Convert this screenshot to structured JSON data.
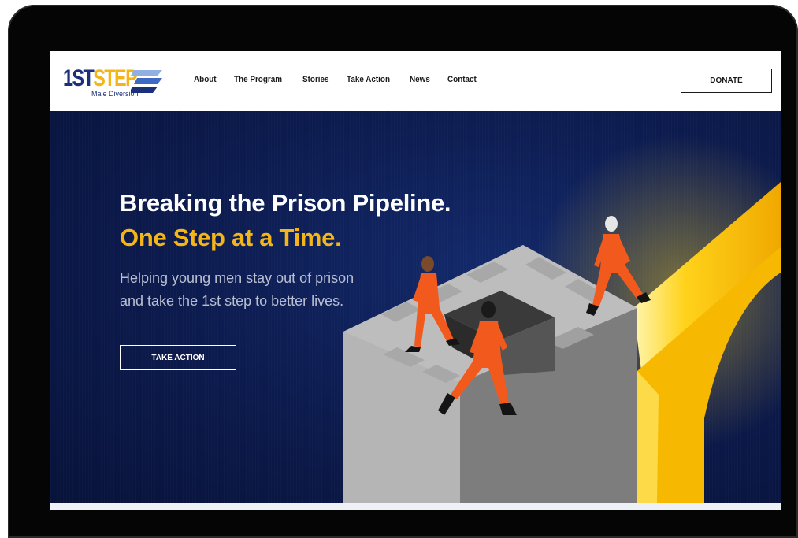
{
  "logo": {
    "part_a": "1ST",
    "part_b": "STEP",
    "subtitle": "Male Diversion"
  },
  "nav": {
    "links": [
      "About",
      "The Program",
      "Stories",
      "Take Action",
      "News",
      "Contact"
    ],
    "donate_label": "DONATE"
  },
  "hero": {
    "headline_line1": "Breaking the Prison Pipeline.",
    "headline_line2": "One Step at a Time.",
    "subtext": "Helping young men stay out of prison and take the 1st step to better lives.",
    "cta_label": "TAKE ACTION"
  },
  "colors": {
    "brand_navy": "#1c2f7a",
    "brand_yellow": "#f4b518",
    "hero_background": "#0c1a4c",
    "jumpsuit_orange": "#f25a1d"
  }
}
